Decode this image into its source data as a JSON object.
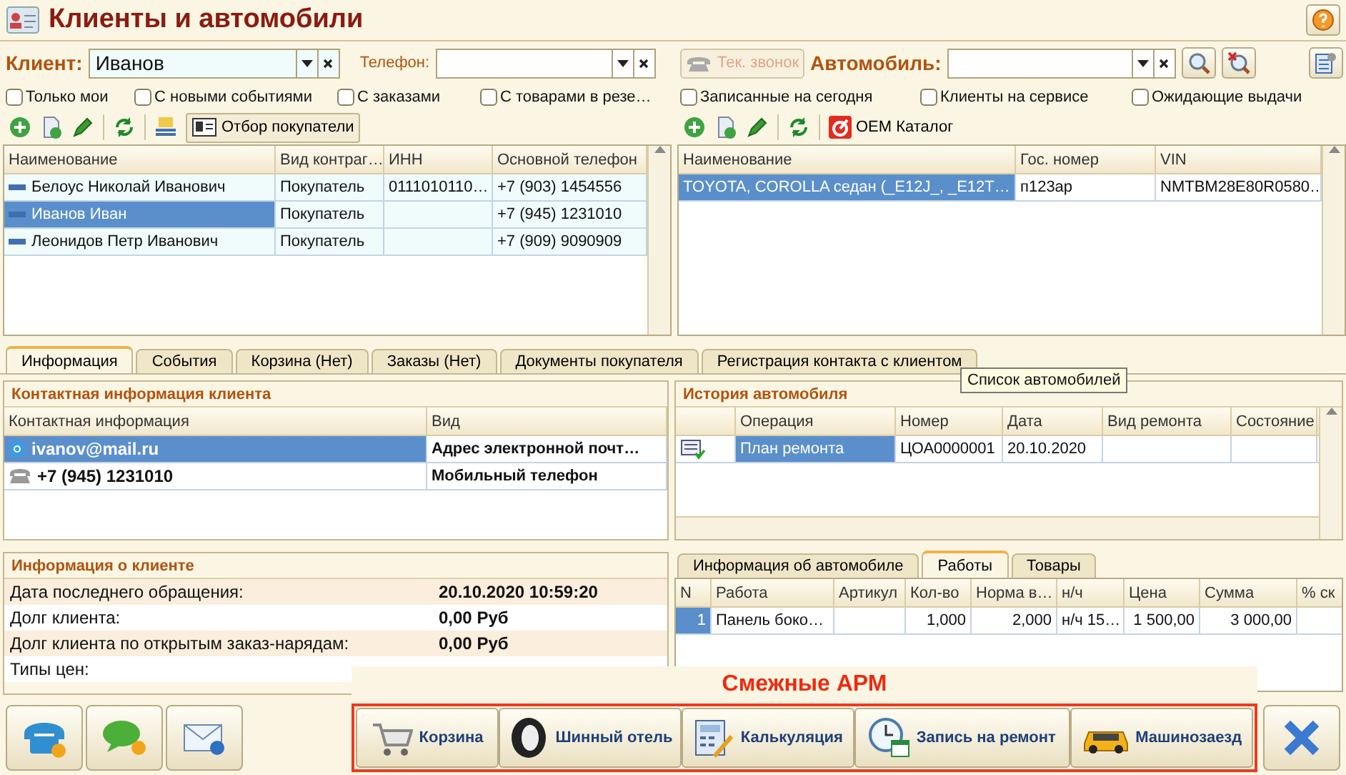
{
  "window": {
    "title": "Клиенты и автомобили"
  },
  "client_filter": {
    "label": "Клиент:",
    "value": "Иванов"
  },
  "phone_filter": {
    "label": "Телефон:"
  },
  "call_button": {
    "label": "Тек. звонок",
    "disabled": true
  },
  "car_filter": {
    "label": "Автомобиль:"
  },
  "client_options": [
    {
      "label": "Только мои",
      "checked": false
    },
    {
      "label": "С новыми событиями",
      "checked": false
    },
    {
      "label": "С заказами",
      "checked": false
    },
    {
      "label": "С товарами в резе…",
      "checked": false
    }
  ],
  "car_options": [
    {
      "label": "Записанные на сегодня",
      "checked": false
    },
    {
      "label": "Клиенты на сервисе",
      "checked": false
    },
    {
      "label": "Ожидающие выдачи",
      "checked": false
    }
  ],
  "client_toolbar": {
    "filter_button": "Отбор покупатели"
  },
  "car_toolbar": {
    "catalog_button": "OEM Каталог"
  },
  "clients_table": {
    "columns": [
      "Наименование",
      "Вид контраг…",
      "ИНН",
      "Основной телефон"
    ],
    "rows": [
      {
        "name": "Белоус Николай Иванович",
        "type": "Покупатель",
        "inn": "0111010110…",
        "phone": "+7 (903) 1454556",
        "selected": false
      },
      {
        "name": "Иванов Иван",
        "type": "Покупатель",
        "phone": "+7 (945) 1231010",
        "selected": true
      },
      {
        "name": "Леонидов Петр Иванович",
        "type": "Покупатель",
        "phone": "+7 (909) 9090909",
        "selected": false
      }
    ]
  },
  "cars_table": {
    "columns": [
      "Наименование",
      "Гос. номер",
      "VIN"
    ],
    "rows": [
      {
        "name": "TOYOTA, COROLLA седан (_E12J_, _E12T…",
        "plate": "п123ар",
        "vin": "NMTBM28E80R0580…",
        "selected": true
      }
    ]
  },
  "tabs": [
    {
      "label": "Информация",
      "selected": true
    },
    {
      "label": "События",
      "selected": false
    },
    {
      "label": "Корзина (Нет)",
      "selected": false
    },
    {
      "label": "Заказы (Нет)",
      "selected": false
    },
    {
      "label": "Документы покупателя",
      "selected": false
    },
    {
      "label": "Регистрация контакта с клиентом",
      "selected": false
    }
  ],
  "tooltip": "Список автомобилей",
  "contacts": {
    "title": "Контактная информация клиента",
    "columns": [
      "Контактная информация",
      "Вид"
    ],
    "rows": [
      {
        "kind": "email",
        "value": "ivanov@mail.ru",
        "type": "Адрес электронной почт…",
        "selected": true
      },
      {
        "kind": "phone",
        "value": "+7 (945) 1231010",
        "type": "Мобильный телефон",
        "selected": false
      }
    ]
  },
  "client_info": {
    "title": "Информация о клиенте",
    "rows": [
      {
        "label": "Дата последнего обращения:",
        "value": "20.10.2020 10:59:20"
      },
      {
        "label": "Долг клиента:",
        "value": "0,00 Руб"
      },
      {
        "label": "Долг клиента по открытым заказ-нарядам:",
        "value": "0,00 Руб"
      },
      {
        "label": "Типы цен:"
      }
    ]
  },
  "car_history": {
    "title": "История автомобиля",
    "columns": [
      "Операция",
      "Номер",
      "Дата",
      "Вид ремонта",
      "Состояние"
    ],
    "rows": [
      {
        "operation": "План ремонта",
        "number": "ЦОА0000001",
        "date": "20.10.2020",
        "selected": true
      }
    ]
  },
  "car_tabs": [
    {
      "label": "Информация об автомобиле",
      "selected": false
    },
    {
      "label": "Работы",
      "selected": true
    },
    {
      "label": "Товары",
      "selected": false
    }
  ],
  "works_table": {
    "columns": [
      "N",
      "Работа",
      "Артикул",
      "Кол-во",
      "Норма в…",
      "н/ч",
      "Цена",
      "Сумма",
      "% ск"
    ],
    "rows": [
      {
        "n": "1",
        "work": "Панель боко…",
        "qty": "1,000",
        "norm": "2,000",
        "unit": "н/ч 15…",
        "price": "1 500,00",
        "sum": "3 000,00",
        "selected": true
      }
    ]
  },
  "related_apps": {
    "title": "Смежные АРМ",
    "buttons": [
      {
        "label": "Корзина",
        "kind": "cart"
      },
      {
        "label": "Шинный отель",
        "kind": "tire"
      },
      {
        "label": "Калькуляция",
        "kind": "calculator"
      },
      {
        "label": "Запись на ремонт",
        "kind": "clock"
      },
      {
        "label": "Машинозаезд",
        "kind": "car"
      }
    ]
  },
  "bottom_buttons": [
    {
      "kind": "phone"
    },
    {
      "kind": "sms"
    },
    {
      "kind": "email"
    }
  ]
}
